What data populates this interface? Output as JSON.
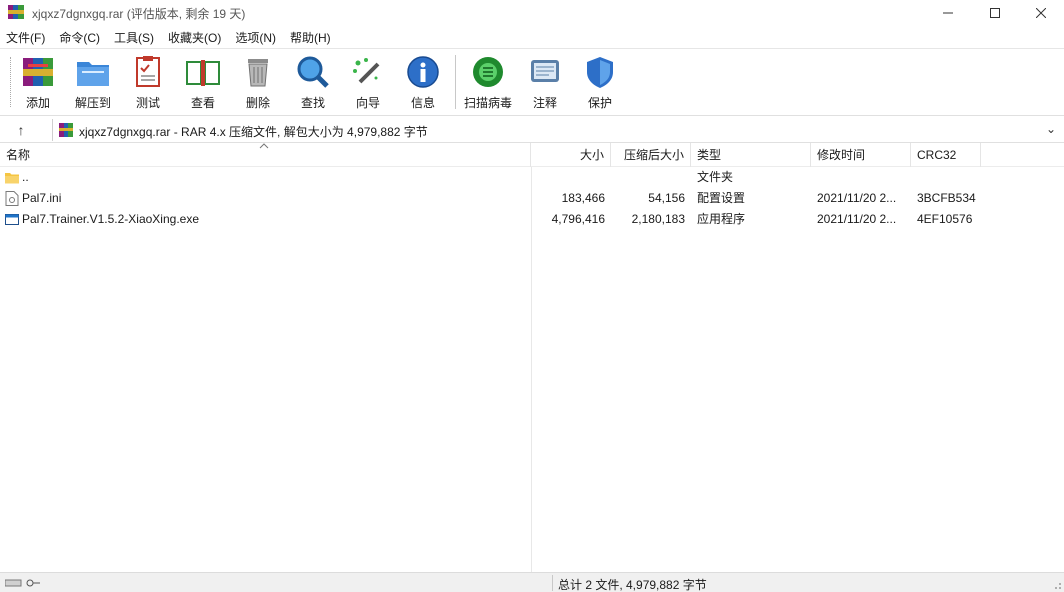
{
  "window": {
    "title": "xjqxz7dgnxgq.rar (评估版本, 剩余 19 天)",
    "minimize": "—",
    "maximize": "☐",
    "close": "✕"
  },
  "menu": [
    {
      "label": "文件(F)"
    },
    {
      "label": "命令(C)"
    },
    {
      "label": "工具(S)"
    },
    {
      "label": "收藏夹(O)"
    },
    {
      "label": "选项(N)"
    },
    {
      "label": "帮助(H)"
    }
  ],
  "toolbar": {
    "add": "添加",
    "extract": "解压到",
    "test": "测试",
    "view": "查看",
    "delete": "删除",
    "find": "查找",
    "wizard": "向导",
    "info": "信息",
    "scan": "扫描病毒",
    "comment": "注释",
    "protect": "保护"
  },
  "address": {
    "up_glyph": "↑",
    "text": "xjqxz7dgnxgq.rar - RAR 4.x 压缩文件, 解包大小为 4,979,882 字节",
    "dropdown_glyph": "⌄"
  },
  "columns": {
    "name": "名称",
    "size": "大小",
    "packed": "压缩后大小",
    "type": "类型",
    "modified": "修改时间",
    "crc": "CRC32"
  },
  "files": [
    {
      "name": "..",
      "size": "",
      "packed": "",
      "type": "文件夹",
      "modified": "",
      "crc": "",
      "icon": "folder-icon"
    },
    {
      "name": "Pal7.ini",
      "size": "183,466",
      "packed": "54,156",
      "type": "配置设置",
      "modified": "2021/11/20 2...",
      "crc": "3BCFB534",
      "icon": "ini-file-icon"
    },
    {
      "name": "Pal7.Trainer.V1.5.2-XiaoXing.exe",
      "size": "4,796,416",
      "packed": "2,180,183",
      "type": "应用程序",
      "modified": "2021/11/20 2...",
      "crc": "4EF10576",
      "icon": "exe-file-icon"
    }
  ],
  "status": {
    "text": "总计 2 文件, 4,979,882 字节"
  },
  "colors": {
    "accent_blue": "#1e73c8",
    "folder_yellow": "#f5c542"
  }
}
